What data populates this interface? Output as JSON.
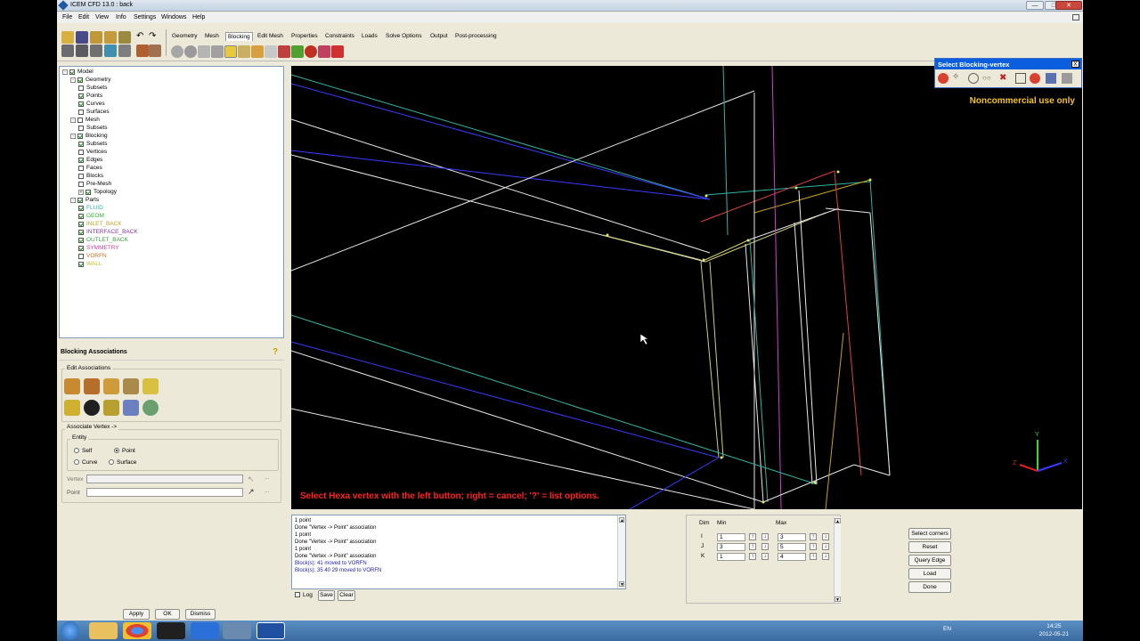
{
  "window": {
    "title": "ICEM CFD 13.0 : back",
    "minimize": "—",
    "maximize": "□",
    "close": "✕"
  },
  "menu": [
    "File",
    "Edit",
    "View",
    "Info",
    "Settings",
    "Windows",
    "Help"
  ],
  "ribbon_tabs": [
    "Geometry",
    "Mesh",
    "Blocking",
    "Edit Mesh",
    "Properties",
    "Constraints",
    "Loads",
    "Solve Options",
    "Output",
    "Post-processing"
  ],
  "active_tab": "Blocking",
  "tree": [
    {
      "label": "Model",
      "level": 0,
      "checked": true,
      "expander": "-"
    },
    {
      "label": "Geometry",
      "level": 1,
      "checked": true,
      "expander": "-"
    },
    {
      "label": "Subsets",
      "level": 2,
      "checked": false
    },
    {
      "label": "Points",
      "level": 2,
      "checked": true
    },
    {
      "label": "Curves",
      "level": 2,
      "checked": true
    },
    {
      "label": "Surfaces",
      "level": 2,
      "checked": false
    },
    {
      "label": "Mesh",
      "level": 1,
      "checked": false,
      "expander": "-"
    },
    {
      "label": "Subsets",
      "level": 2,
      "checked": false
    },
    {
      "label": "Blocking",
      "level": 1,
      "checked": true,
      "expander": "-"
    },
    {
      "label": "Subsets",
      "level": 2,
      "checked": true
    },
    {
      "label": "Vertices",
      "level": 2,
      "checked": false
    },
    {
      "label": "Edges",
      "level": 2,
      "checked": true
    },
    {
      "label": "Faces",
      "level": 2,
      "checked": false
    },
    {
      "label": "Blocks",
      "level": 2,
      "checked": false
    },
    {
      "label": "Pre-Mesh",
      "level": 2,
      "checked": false
    },
    {
      "label": "Topology",
      "level": 2,
      "checked": true,
      "expander": "+"
    },
    {
      "label": "Parts",
      "level": 1,
      "checked": true,
      "expander": "-"
    },
    {
      "label": "FLUID",
      "level": 2,
      "checked": true,
      "color": "#2fb5a0"
    },
    {
      "label": "GEOM",
      "level": 2,
      "checked": true,
      "color": "#30b030"
    },
    {
      "label": "INLET_BACK",
      "level": 2,
      "checked": true,
      "color": "#c8a020"
    },
    {
      "label": "INTERFACE_BACK",
      "level": 2,
      "checked": true,
      "color": "#8a35b0"
    },
    {
      "label": "OUTLET_BACK",
      "level": 2,
      "checked": true,
      "color": "#3aa040"
    },
    {
      "label": "SYMMETRY",
      "level": 2,
      "checked": true,
      "color": "#d040a0"
    },
    {
      "label": "VORFN",
      "level": 2,
      "checked": false,
      "color": "#d07020"
    },
    {
      "label": "WALL",
      "level": 2,
      "checked": true,
      "color": "#c0c030"
    }
  ],
  "assoc": {
    "title": "Blocking Associations",
    "edit_group": "Edit Associations",
    "assoc_vertex_group": "Associate Vertex ->",
    "entity_group": "Entity",
    "entity_options": [
      "Self",
      "Point",
      "Curve",
      "Surface"
    ],
    "entity_selected": "Point",
    "vertex_label": "Vertex",
    "point_label": "Point",
    "dots": "...",
    "vertex_value": "",
    "point_value": ""
  },
  "footer_buttons": {
    "apply": "Apply",
    "ok": "OK",
    "dismiss": "Dismiss"
  },
  "viewport": {
    "status": "Select Hexa vertex with the left button; right = cancel; '?' = list options.",
    "watermark": "Noncommercial use only",
    "axis_x": "X",
    "axis_y": "Y",
    "axis_z": "Z"
  },
  "selbar": {
    "title": "Select Blocking-vertex",
    "close": "X"
  },
  "messages": [
    {
      "text": "1 point",
      "color": "black"
    },
    {
      "text": "Done \"Vertex -> Point\" association",
      "color": "black"
    },
    {
      "text": "1 point",
      "color": "black"
    },
    {
      "text": "Done \"Vertex -> Point\" association",
      "color": "black"
    },
    {
      "text": "1 point",
      "color": "black"
    },
    {
      "text": "Done \"Vertex -> Point\" association",
      "color": "black"
    },
    {
      "text": "Block(s): 41 moved to VORFN",
      "color": "blue"
    },
    {
      "text": "Block(s): 35 40 29 moved to VORFN",
      "color": "blue"
    }
  ],
  "msg_controls": {
    "log": "Log",
    "save": "Save",
    "clear": "Clear"
  },
  "dims": {
    "dim_header": "Dim",
    "min_header": "Min",
    "max_header": "Max",
    "rows": [
      {
        "dim": "I",
        "min": "1",
        "max": "3"
      },
      {
        "dim": "J",
        "min": "3",
        "max": "5"
      },
      {
        "dim": "K",
        "min": "1",
        "max": "4"
      }
    ]
  },
  "right_buttons": [
    "Select corners",
    "Reset",
    "Query Edge",
    "Load",
    "Done"
  ],
  "taskbar": {
    "lang": "EN",
    "time": "14:25",
    "date": "2012-05-21"
  },
  "icons": [
    "windows-start",
    "explorer",
    "chrome",
    "terminal",
    "icem",
    "network",
    "screen-capture"
  ]
}
